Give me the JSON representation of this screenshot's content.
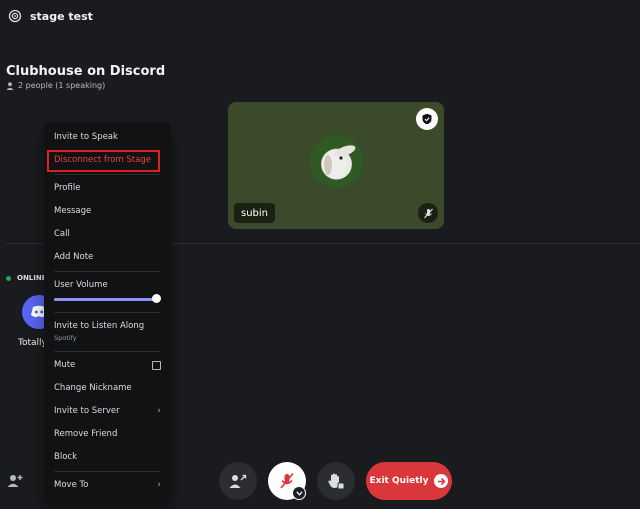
{
  "header": {
    "title": "stage test"
  },
  "stage": {
    "topic": "Clubhouse on Discord",
    "people_count": "2 people (1 speaking)"
  },
  "speaker": {
    "name": "subin"
  },
  "audience": {
    "online_label": "ONLINE",
    "listener_name": "Totally"
  },
  "context_menu": {
    "items": {
      "invite_to_speak": "Invite to Speak",
      "disconnect": "Disconnect from Stage",
      "profile": "Profile",
      "message": "Message",
      "call": "Call",
      "add_note": "Add Note",
      "user_volume": "User Volume",
      "invite_listen": "Invite to Listen Along",
      "invite_listen_sub": "Spotify",
      "mute": "Mute",
      "change_nickname": "Change Nickname",
      "invite_server": "Invite to Server",
      "remove_friend": "Remove Friend",
      "block": "Block",
      "move_to": "Move To"
    },
    "user_volume_level": 1.0,
    "mute_checked": false,
    "highlighted_item": "Disconnect from Stage"
  },
  "controls": {
    "exit_label": "Exit Quietly"
  },
  "colors": {
    "accent": "#5865f2",
    "danger": "#da373c",
    "online": "#23a55a",
    "tile_bg": "#3b4a2b"
  }
}
